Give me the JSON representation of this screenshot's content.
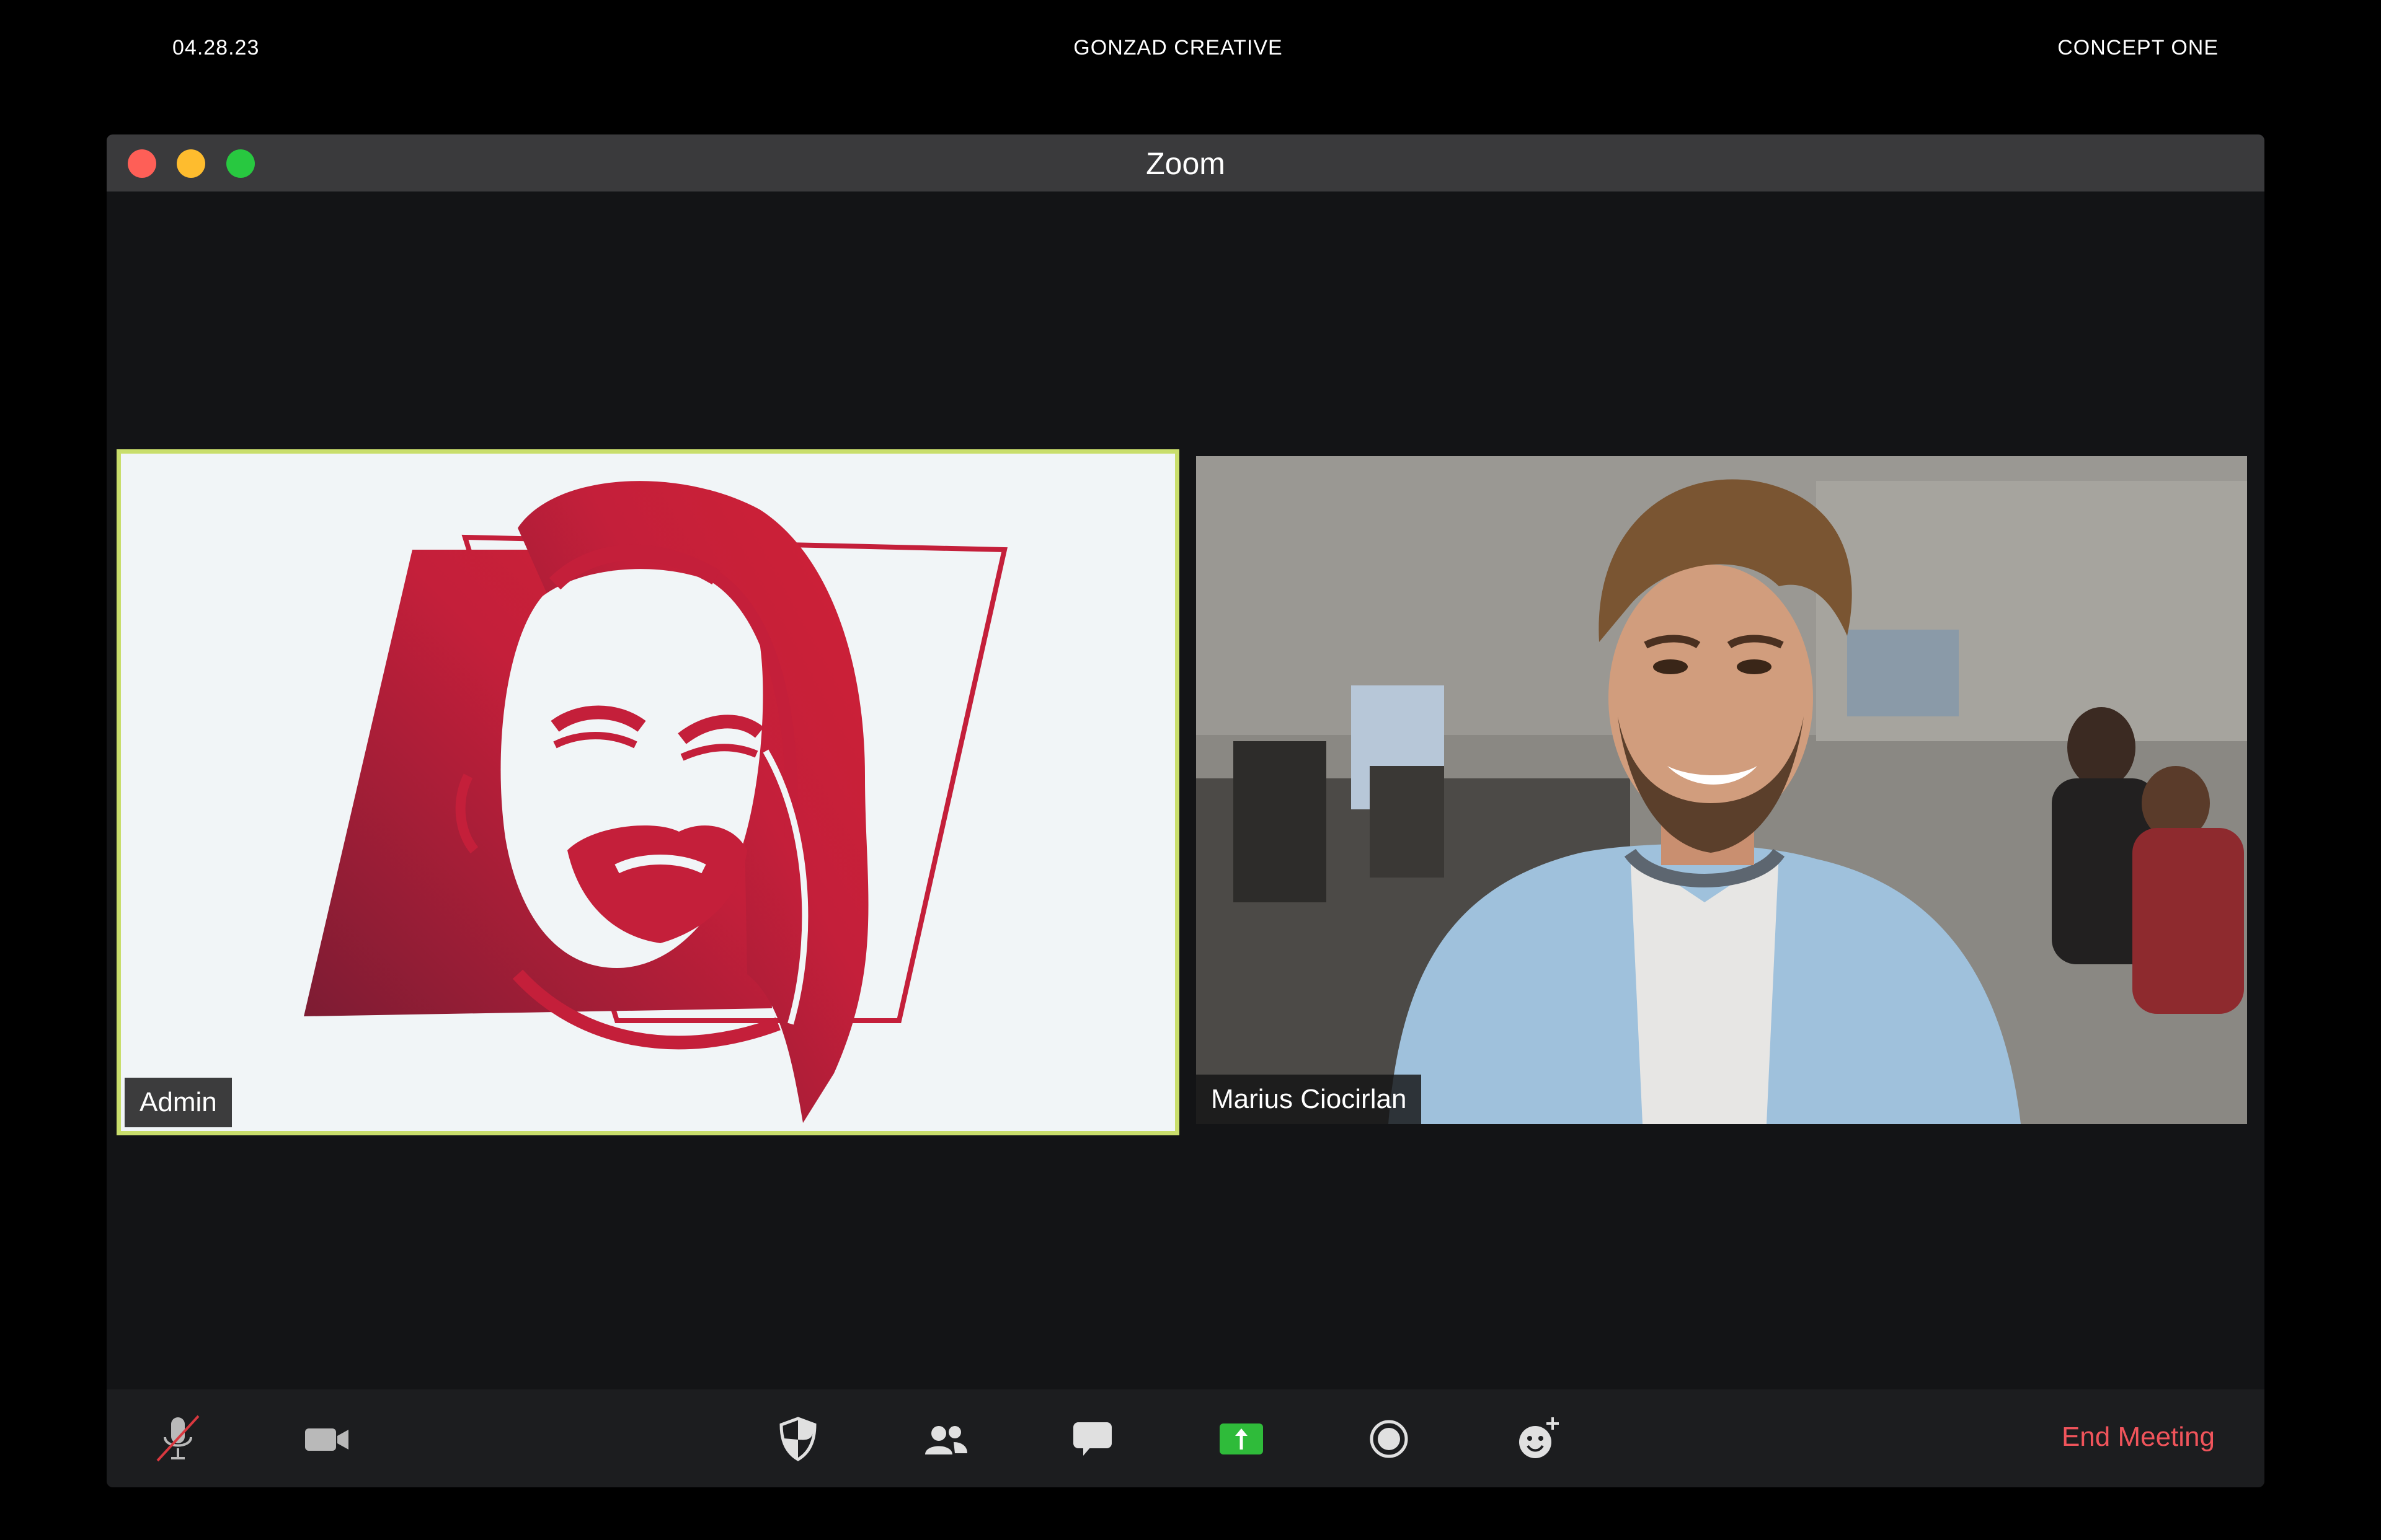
{
  "header": {
    "date": "04.28.23",
    "studio": "GONZAD CREATIVE",
    "concept": "CONCEPT ONE"
  },
  "window": {
    "title": "Zoom"
  },
  "participants": [
    {
      "name": "Admin",
      "active_speaker": true
    },
    {
      "name": "Marius Ciocirlan",
      "active_speaker": false
    }
  ],
  "toolbar": {
    "end_meeting_label": "End Meeting",
    "buttons": [
      "microphone-muted-icon",
      "video-camera-icon",
      "security-shield-icon",
      "participants-icon",
      "chat-icon",
      "share-screen-icon",
      "record-icon",
      "reactions-icon"
    ]
  },
  "colors": {
    "active_speaker_border": "#c9de6c",
    "end_meeting": "#f0545b",
    "share_screen": "#2fbb3a",
    "logo_red": "#c41f3a"
  }
}
